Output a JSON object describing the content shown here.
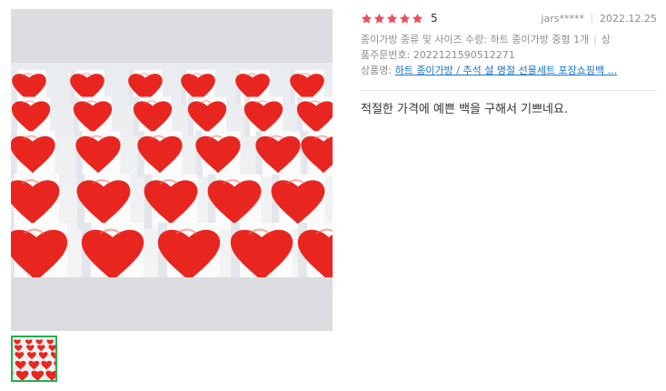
{
  "review": {
    "rating": 5,
    "rating_text": "5",
    "star_color": "#f04a5c",
    "author": "jars*****",
    "date": "2022.12.25",
    "option_label": "종이가방 종류 및 사이즈 수량: 하트 종이가방 중형 1개",
    "option_tail": "상",
    "order_number_line": "품주문번호: 2022121590512271",
    "product_name_label": "상품명:",
    "product_name_link": "하트 종이가방 / 추석 설 명절 선물세트 포장쇼핑백 ...",
    "body": "적절한 가격에 예쁜 백을 구해서 기쁘네요."
  },
  "media": {
    "main_photo": "heart-paper-bags-photo",
    "thumbnail_selected_border": "#22b14c"
  },
  "colors": {
    "link": "#1a73c9",
    "heart_red": "#e8261f"
  }
}
